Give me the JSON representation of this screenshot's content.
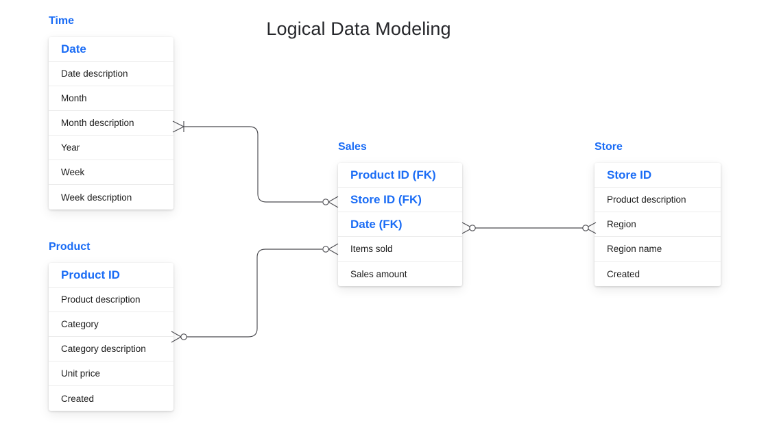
{
  "title": "Logical Data Modeling",
  "colors": {
    "accent_blue": "#1a6cf5",
    "text": "#1c1c1c",
    "title": "#26272b",
    "connector": "#4a4a4f",
    "row_divider": "#ececec",
    "background": "#ffffff"
  },
  "entities": [
    {
      "id": "time",
      "label": "Time",
      "attributes": [
        {
          "name": "Date",
          "key": true
        },
        {
          "name": "Date description",
          "key": false
        },
        {
          "name": "Month",
          "key": false
        },
        {
          "name": "Month description",
          "key": false
        },
        {
          "name": "Year",
          "key": false
        },
        {
          "name": "Week",
          "key": false
        },
        {
          "name": "Week description",
          "key": false
        }
      ]
    },
    {
      "id": "product",
      "label": "Product",
      "attributes": [
        {
          "name": "Product ID",
          "key": true
        },
        {
          "name": "Product description",
          "key": false
        },
        {
          "name": "Category",
          "key": false
        },
        {
          "name": "Category description",
          "key": false
        },
        {
          "name": "Unit price",
          "key": false
        },
        {
          "name": "Created",
          "key": false
        }
      ]
    },
    {
      "id": "sales",
      "label": "Sales",
      "attributes": [
        {
          "name": "Product ID (FK)",
          "key": true
        },
        {
          "name": "Store ID (FK)",
          "key": true
        },
        {
          "name": "Date (FK)",
          "key": true
        },
        {
          "name": "Items sold",
          "key": false
        },
        {
          "name": "Sales amount",
          "key": false
        }
      ]
    },
    {
      "id": "store",
      "label": "Store",
      "attributes": [
        {
          "name": "Store ID",
          "key": true
        },
        {
          "name": "Product description",
          "key": false
        },
        {
          "name": "Region",
          "key": false
        },
        {
          "name": "Region name",
          "key": false
        },
        {
          "name": "Created",
          "key": false
        }
      ]
    }
  ],
  "relationships": [
    {
      "id": "time-sales",
      "from": "time",
      "to": "sales",
      "from_cardinality": "one-or-many",
      "to_cardinality": "zero-or-many"
    },
    {
      "id": "product-sales",
      "from": "product",
      "to": "sales",
      "from_cardinality": "zero-or-many",
      "to_cardinality": "zero-or-many"
    },
    {
      "id": "sales-store",
      "from": "sales",
      "to": "store",
      "from_cardinality": "zero-or-many",
      "to_cardinality": "zero-or-many"
    }
  ]
}
